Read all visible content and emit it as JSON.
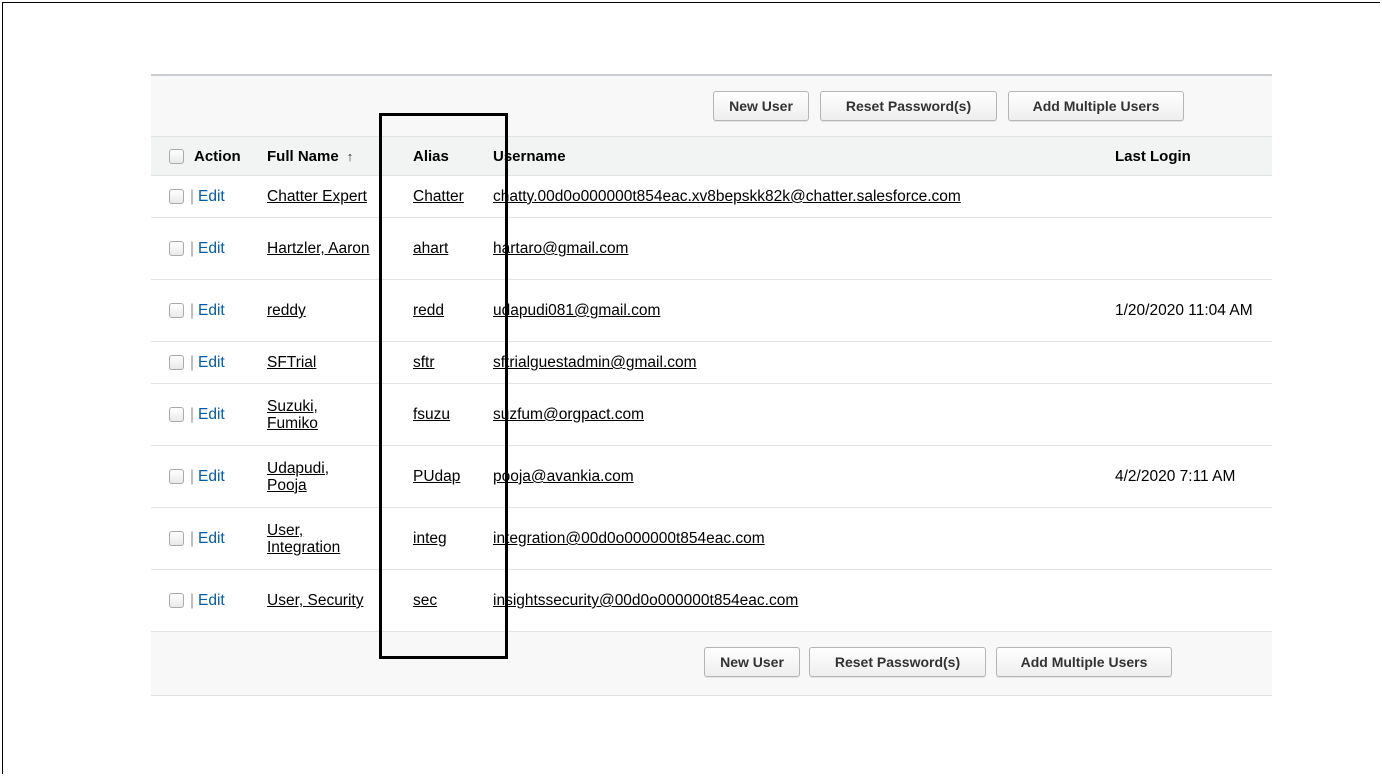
{
  "buttons": {
    "new_user": "New User",
    "reset_password": "Reset Password(s)",
    "add_multiple_users": "Add Multiple Users"
  },
  "columns": {
    "action": "Action",
    "full_name": "Full Name",
    "full_name_sort_icon": "↑",
    "alias": "Alias",
    "username": "Username",
    "last_login": "Last Login"
  },
  "row_action": {
    "separator": "|",
    "edit": "Edit"
  },
  "rows": [
    {
      "full_name": "Chatter Expert",
      "alias": "Chatter",
      "username": "chatty.00d0o000000t854eac.xv8bepskk82k@chatter.salesforce.com",
      "last_login": ""
    },
    {
      "full_name": "Hartzler, Aaron",
      "alias": "ahart",
      "username": "hartaro@gmail.com",
      "last_login": ""
    },
    {
      "full_name": "reddy",
      "alias": "redd",
      "username": "udapudi081@gmail.com",
      "last_login": "1/20/2020 11:04 AM"
    },
    {
      "full_name": "SFTrial",
      "alias": "sftr",
      "username": "sftrialguestadmin@gmail.com",
      "last_login": ""
    },
    {
      "full_name": "Suzuki, Fumiko",
      "alias": "fsuzu",
      "username": "suzfum@orgpact.com",
      "last_login": ""
    },
    {
      "full_name": "Udapudi, Pooja",
      "alias": "PUdap",
      "username": "pooja@avankia.com",
      "last_login": "4/2/2020 7:11 AM"
    },
    {
      "full_name": "User, Integration",
      "alias": "integ",
      "username": "integration@00d0o000000t854eac.com",
      "last_login": ""
    },
    {
      "full_name": "User, Security",
      "alias": "sec",
      "username": "insightssecurity@00d0o000000t854eac.com",
      "last_login": ""
    }
  ],
  "colors": {
    "edit_link": "#015ba7",
    "header_bg": "#f2f3f3",
    "highlight_box": "#000000"
  }
}
